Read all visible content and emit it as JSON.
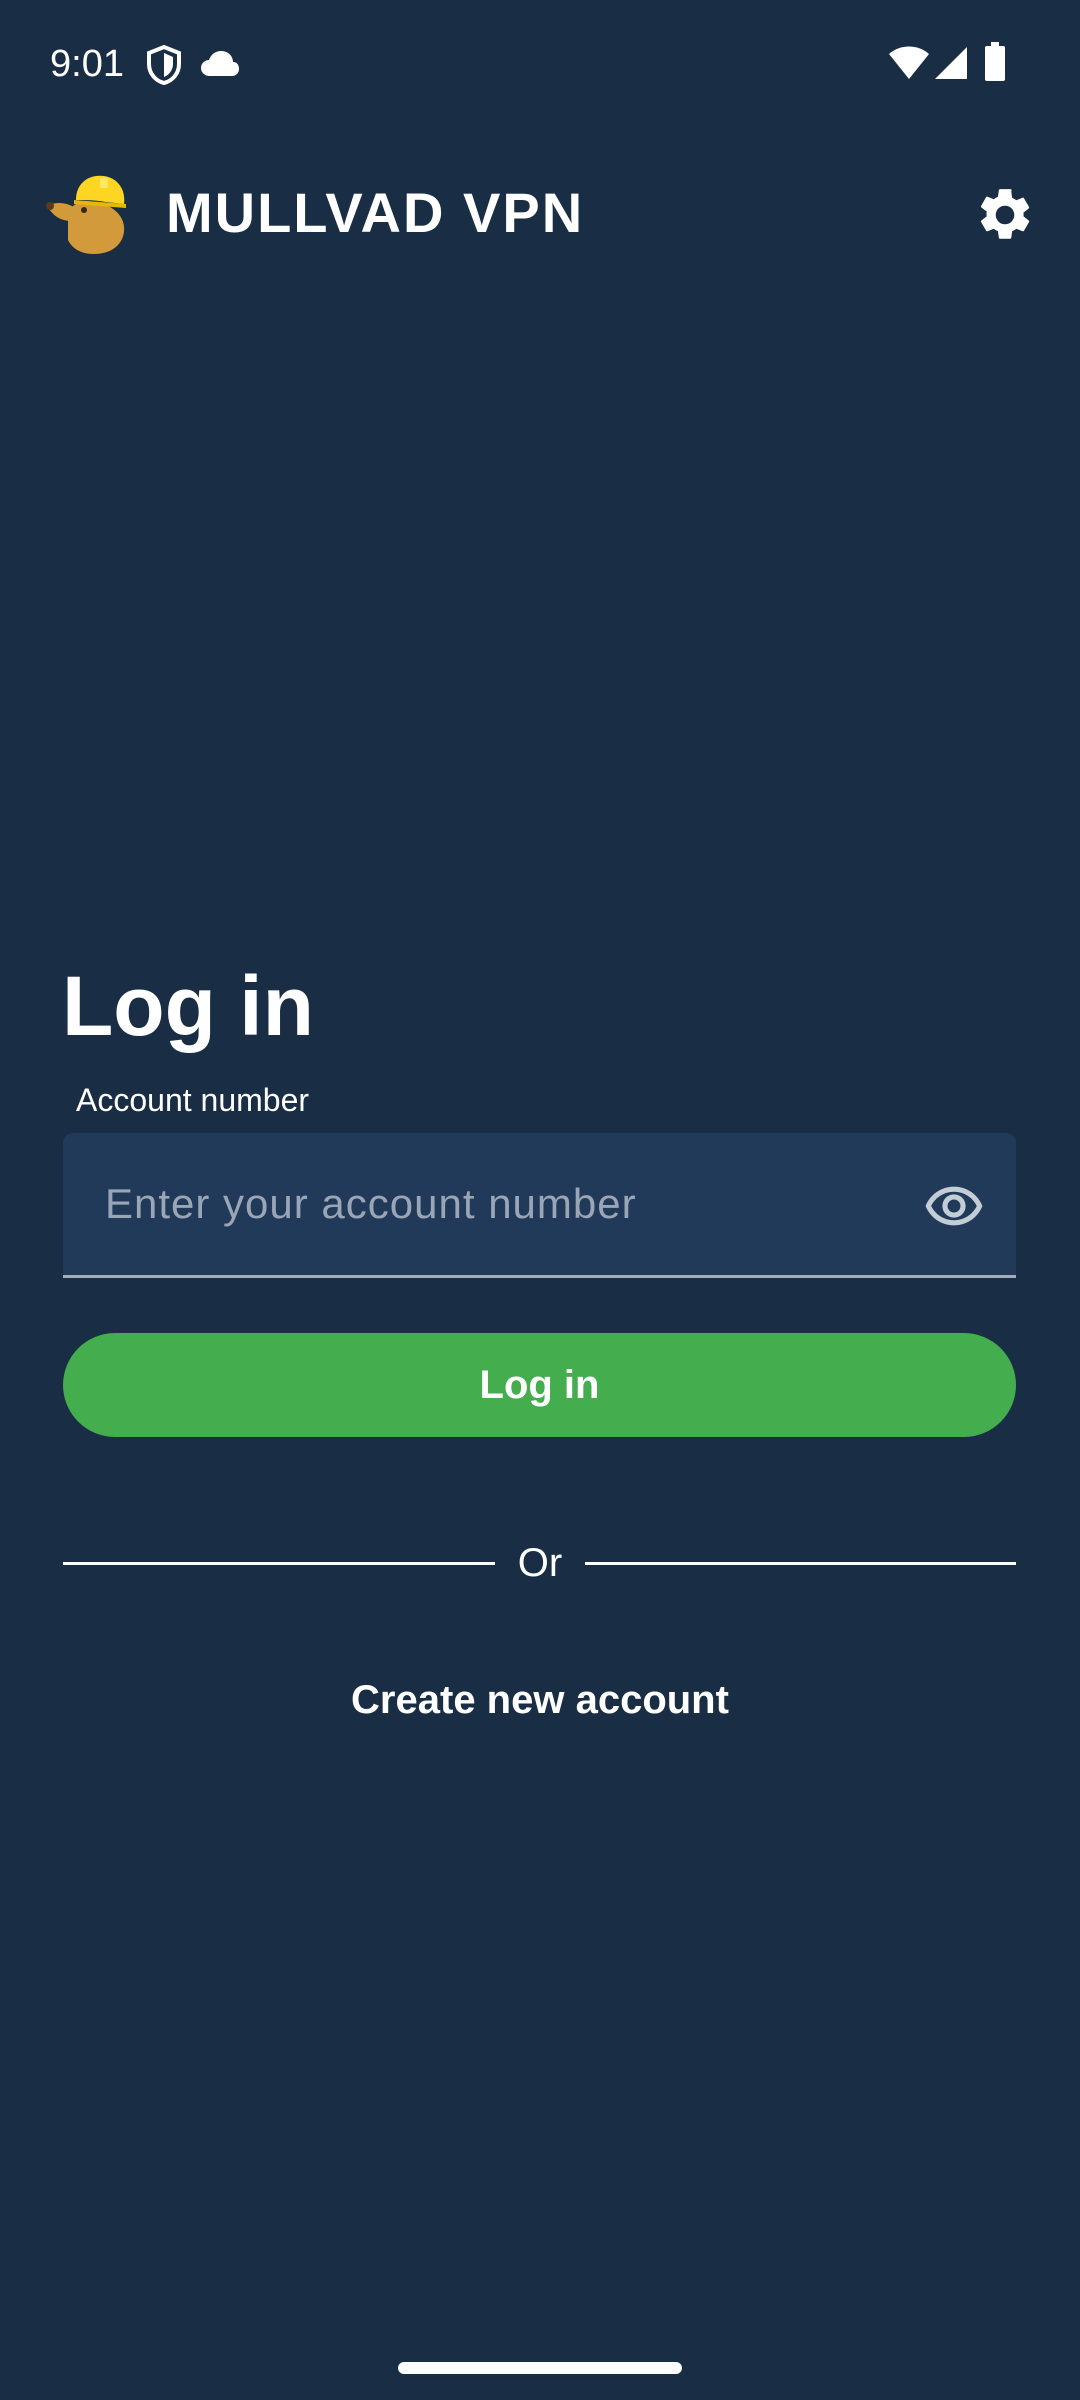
{
  "status_bar": {
    "time": "9:01",
    "icons": [
      "vpn-shield-icon",
      "cloud-icon",
      "wifi-icon",
      "cell-signal-icon",
      "battery-icon"
    ]
  },
  "header": {
    "app_title": "MULLVAD VPN",
    "logo_icon": "mullvad-mole-logo",
    "settings_icon": "gear-icon"
  },
  "login": {
    "title": "Log in",
    "account_label": "Account number",
    "account_value": "",
    "account_placeholder": "Enter your account number",
    "visibility_icon": "eye-icon",
    "login_button": "Log in",
    "divider_text": "Or",
    "create_account": "Create new account"
  },
  "colors": {
    "background": "#192e45",
    "input_background": "#213a5a",
    "primary_green": "#44ad4d",
    "text": "#ffffff",
    "placeholder": "#9aa6b6",
    "logo_helmet": "#ffd524",
    "logo_mole": "#d39a3c"
  }
}
